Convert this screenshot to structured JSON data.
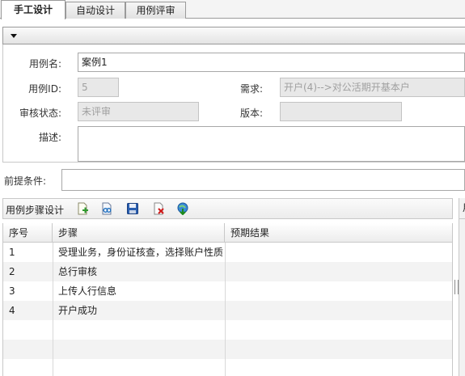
{
  "tabs": [
    {
      "label": "手工设计",
      "active": true
    },
    {
      "label": "自动设计",
      "active": false
    },
    {
      "label": "用例评审",
      "active": false
    }
  ],
  "form": {
    "case_name_label": "用例名:",
    "case_name_value": "案例1",
    "case_id_label": "用例ID:",
    "case_id_value": "5",
    "requirement_label": "需求:",
    "requirement_value": "开户(4)-->对公活期开基本户",
    "review_status_label": "审核状态:",
    "review_status_value": "未评审",
    "version_label": "版本:",
    "version_value": "",
    "description_label": "描述:",
    "description_value": ""
  },
  "precondition": {
    "label": "前提条件:",
    "value": ""
  },
  "steps": {
    "title": "用例步骤设计",
    "side_header": "用",
    "toolbar_icons": [
      "add-step-icon",
      "link-step-icon",
      "save-icon",
      "delete-icon",
      "import-icon"
    ],
    "columns": [
      "序号",
      "步骤",
      "预期结果"
    ],
    "rows": [
      {
        "no": "1",
        "step": "受理业务，身份证核查，选择账户性质",
        "expected": ""
      },
      {
        "no": "2",
        "step": "总行审核",
        "expected": ""
      },
      {
        "no": "3",
        "step": "上传人行信息",
        "expected": ""
      },
      {
        "no": "4",
        "step": "开户成功",
        "expected": ""
      }
    ]
  },
  "colors": {
    "tab_border": "#9a9a9a",
    "disabled_bg": "#e8e8e8",
    "alt_row": "#f3f3f3"
  }
}
